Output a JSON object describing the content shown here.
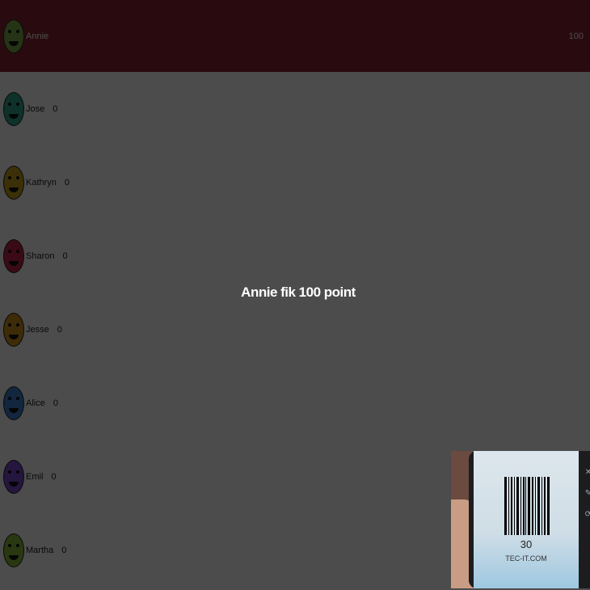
{
  "players": [
    {
      "name": "Annie",
      "score": "100",
      "leader": true,
      "color": "#7fb04a",
      "avatar": "annie-avatar-icon"
    },
    {
      "name": "Jose",
      "score": "0",
      "leader": false,
      "color": "#2fa88a",
      "avatar": "jose-avatar-icon"
    },
    {
      "name": "Kathryn",
      "score": "0",
      "leader": false,
      "color": "#c7a11a",
      "avatar": "kathryn-avatar-icon"
    },
    {
      "name": "Sharon",
      "score": "0",
      "leader": false,
      "color": "#c4244a",
      "avatar": "sharon-avatar-icon"
    },
    {
      "name": "Jesse",
      "score": "0",
      "leader": false,
      "color": "#d08f1a",
      "avatar": "jesse-avatar-icon"
    },
    {
      "name": "Alice",
      "score": "0",
      "leader": false,
      "color": "#3c7fd0",
      "avatar": "alice-avatar-icon"
    },
    {
      "name": "Emil",
      "score": "0",
      "leader": false,
      "color": "#7a4ad0",
      "avatar": "emil-avatar-icon"
    },
    {
      "name": "Martha",
      "score": "0",
      "leader": false,
      "color": "#8bbb3a",
      "avatar": "martha-avatar-icon"
    }
  ],
  "toast": {
    "message": "Annie fik 100 point"
  },
  "camera": {
    "barcode_number": "30",
    "barcode_site": "TEC-IT.COM",
    "side_icons": [
      "close-icon",
      "flashlight-icon",
      "camera-switch-icon"
    ]
  },
  "colors": {
    "leader_row": "#8a2633",
    "overlay": "rgba(0,0,0,0.7)"
  }
}
